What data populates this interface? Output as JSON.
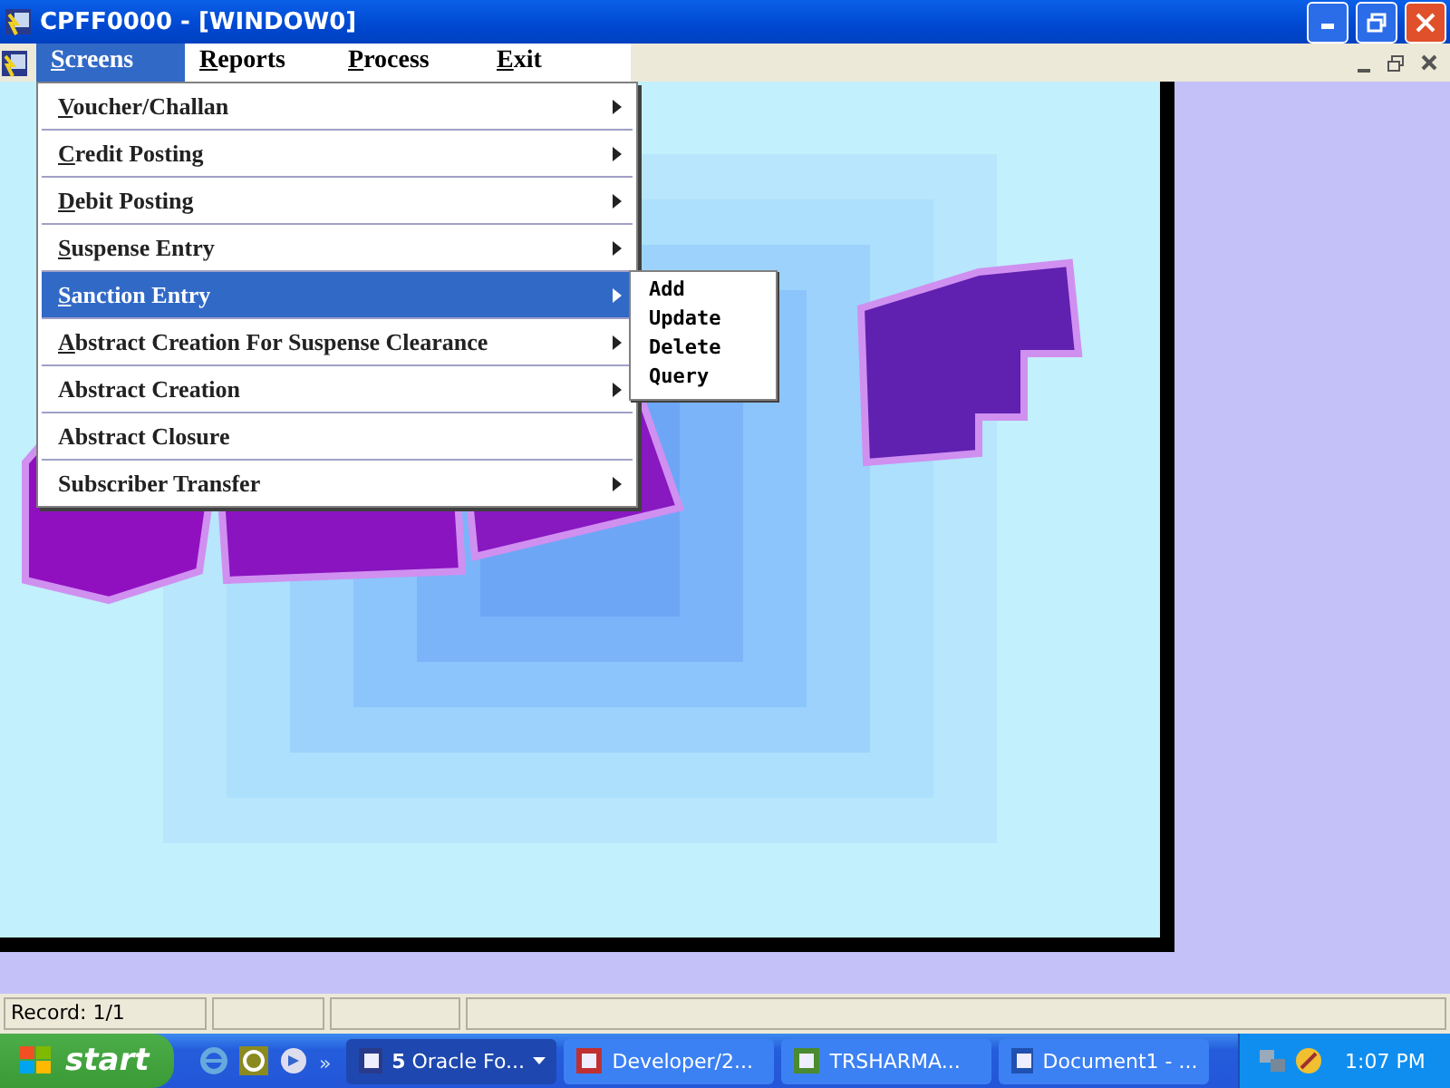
{
  "window": {
    "title": "CPFF0000 - [WINDOW0]"
  },
  "menu_bar": [
    {
      "label": "Screens",
      "selected": true,
      "mnemonic": true
    },
    {
      "label": "Reports",
      "selected": false,
      "mnemonic": true
    },
    {
      "label": "Process",
      "selected": false,
      "mnemonic": true
    },
    {
      "label": "Exit",
      "selected": false,
      "mnemonic": true
    }
  ],
  "menu": [
    {
      "label": "Voucher/Challan",
      "mnemonic": true,
      "submenu": true,
      "selected": false
    },
    {
      "label": "Credit Posting",
      "mnemonic": true,
      "submenu": true,
      "selected": false
    },
    {
      "label": "Debit Posting",
      "mnemonic": true,
      "submenu": true,
      "selected": false
    },
    {
      "label": "Suspense Entry",
      "mnemonic": true,
      "submenu": true,
      "selected": false
    },
    {
      "label": "Sanction Entry",
      "mnemonic": true,
      "submenu": true,
      "selected": true
    },
    {
      "label": "Abstract Creation For Suspense Clearance",
      "mnemonic": true,
      "submenu": true,
      "selected": false
    },
    {
      "label": "Abstract Creation",
      "mnemonic": false,
      "submenu": true,
      "selected": false
    },
    {
      "label": "Abstract Closure",
      "mnemonic": false,
      "submenu": false,
      "selected": false
    },
    {
      "label": "Subscriber Transfer",
      "mnemonic": false,
      "submenu": true,
      "selected": false
    }
  ],
  "submenu": [
    "Add",
    "Update",
    "Delete",
    "Query"
  ],
  "status_bar": {
    "record": "Record: 1/1"
  },
  "taskbar": {
    "start": "start",
    "more": "»",
    "tasks": [
      {
        "label": "**5** Oracle Fo...",
        "selected": true,
        "dropdown": true
      },
      {
        "label": "Developer/2...",
        "selected": false,
        "dropdown": false
      },
      {
        "label": "TRSHARMA...",
        "selected": false,
        "dropdown": false
      },
      {
        "label": "Document1 - ...",
        "selected": false,
        "dropdown": false
      }
    ],
    "clock": "1:07 PM"
  }
}
